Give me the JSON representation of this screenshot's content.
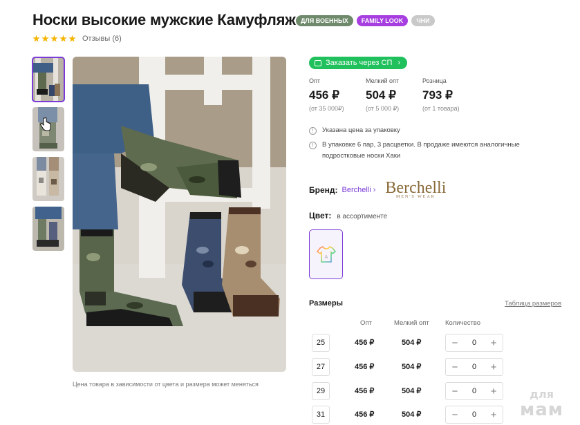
{
  "product": {
    "title": "Носки высокие мужские Камуфляж",
    "badges": [
      {
        "label": "для военных",
        "color": "#6e8a6a"
      },
      {
        "label": "FAMILY LOOK",
        "color": "#a63ee0"
      },
      {
        "label": "ЧНИ",
        "color": "#c9c9c9"
      }
    ],
    "rating_stars": 5,
    "reviews": "Отзывы (6)"
  },
  "gallery": {
    "thumbnails": [
      "thumb-1",
      "thumb-2",
      "thumb-3",
      "thumb-4"
    ],
    "active_index": 0,
    "caption": "Цена товара в зависимости от цвета и размера может меняться"
  },
  "order_button": {
    "label": "Заказать через СП"
  },
  "prices": [
    {
      "label": "Опт",
      "value": "456 ₽",
      "note": "(от 35 000₽)"
    },
    {
      "label": "Мелкий опт",
      "value": "504 ₽",
      "note": "(от 5 000 ₽)"
    },
    {
      "label": "Розница",
      "value": "793 ₽",
      "note": "(от 1 товара)"
    }
  ],
  "info": {
    "line1": "Указана цена за упаковку",
    "line2a": "В упаковке 6 пар, 3 расцветки. В продаже имеются аналогичные",
    "line2b": "подростковые носки Хаки"
  },
  "brand": {
    "label": "Бренд:",
    "name": "Berchelli",
    "logo_text": "Berchelli",
    "logo_sub": "MEN'S WEAR"
  },
  "color": {
    "label": "Цвет:",
    "value": "в ассортименте"
  },
  "sizes": {
    "title": "Размеры",
    "table_link": "Таблица размеров",
    "headers": {
      "opt": "Опт",
      "small_opt": "Мелкий опт",
      "qty": "Количество"
    },
    "rows": [
      {
        "size": "25",
        "opt": "456 ₽",
        "small_opt": "504 ₽",
        "qty": "0"
      },
      {
        "size": "27",
        "opt": "456 ₽",
        "small_opt": "504 ₽",
        "qty": "0"
      },
      {
        "size": "29",
        "opt": "456 ₽",
        "small_opt": "504 ₽",
        "qty": "0"
      },
      {
        "size": "31",
        "opt": "456 ₽",
        "small_opt": "504 ₽",
        "qty": "0"
      }
    ],
    "minus": "−",
    "plus": "+"
  },
  "watermark": {
    "line1": "для",
    "line2": "мам"
  }
}
